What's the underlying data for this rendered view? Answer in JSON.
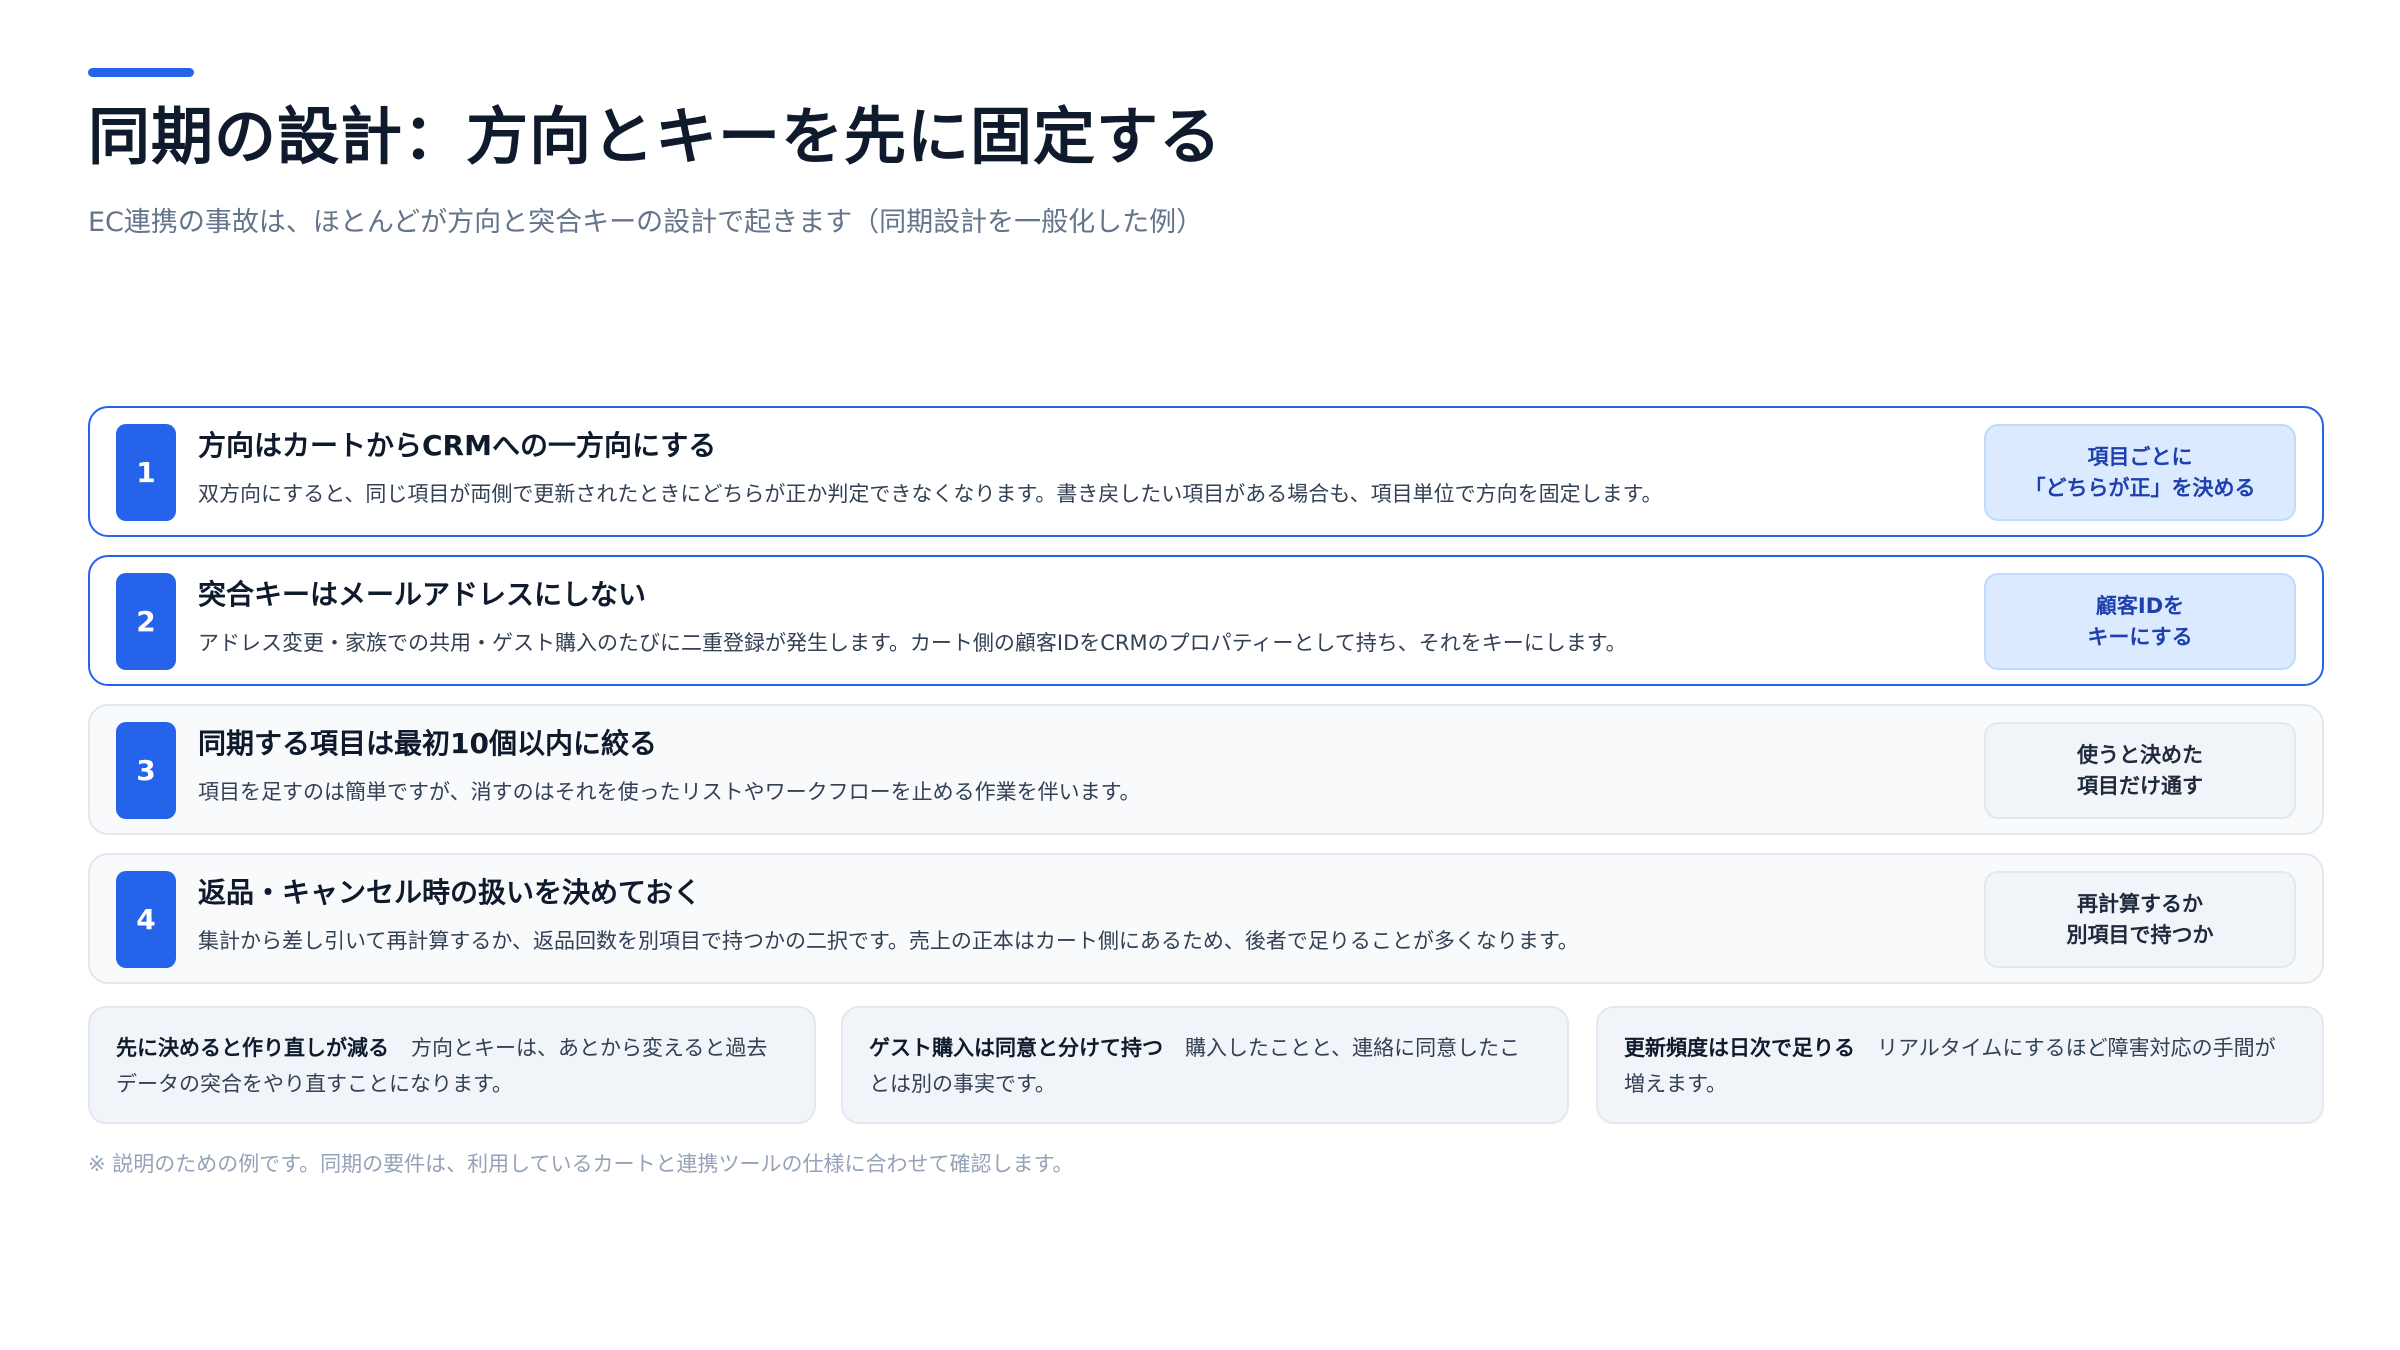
{
  "header": {
    "title": "同期の設計：方向とキーを先に固定する",
    "subtitle": "EC連携の事故は、ほとんどが方向と突合キーの設計で起きます（同期設計を一般化した例）"
  },
  "items": [
    {
      "number": "1",
      "title": "方向はカートからCRMへの一方向にする",
      "description": "双方向にすると、同じ項目が両側で更新されたときにどちらが正か判定できなくなります。書き戻したい項目がある場合も、項目単位で方向を固定します。",
      "tag_line1": "項目ごとに",
      "tag_line2": "「どちらが正」を決める"
    },
    {
      "number": "2",
      "title": "突合キーはメールアドレスにしない",
      "description": "アドレス変更・家族での共用・ゲスト購入のたびに二重登録が発生します。カート側の顧客IDをCRMのプロパティーとして持ち、それをキーにします。",
      "tag_line1": "顧客IDを",
      "tag_line2": "キーにする"
    },
    {
      "number": "3",
      "title": "同期する項目は最初10個以内に絞る",
      "description": "項目を足すのは簡単ですが、消すのはそれを使ったリストやワークフローを止める作業を伴います。",
      "tag_line1": "使うと決めた",
      "tag_line2": "項目だけ通す"
    },
    {
      "number": "4",
      "title": "返品・キャンセル時の扱いを決めておく",
      "description": "集計から差し引いて再計算するか、返品回数を別項目で持つかの二択です。売上の正本はカート側にあるため、後者で足りることが多くなります。",
      "tag_line1": "再計算するか",
      "tag_line2": "別項目で持つか"
    }
  ],
  "notes": [
    {
      "lead": "先に決めると作り直しが減る",
      "body": "方向とキーは、あとから変えると過去データの突合をやり直すことになります。"
    },
    {
      "lead": "ゲスト購入は同意と分けて持つ",
      "body": "購入したことと、連絡に同意したことは別の事実です。"
    },
    {
      "lead": "更新頻度は日次で足りる",
      "body": "リアルタイムにするほど障害対応の手間が増えます。"
    }
  ],
  "footnote": "※ 説明のための例です。同期の要件は、利用しているカートと連携ツールの仕様に合わせて確認します。",
  "colors": {
    "accent": "#2563eb",
    "title": "#0f1b2d",
    "subtitle": "#64748b",
    "tag_highlight_bg": "#dbeafe",
    "tag_highlight_text": "#1e40af"
  }
}
